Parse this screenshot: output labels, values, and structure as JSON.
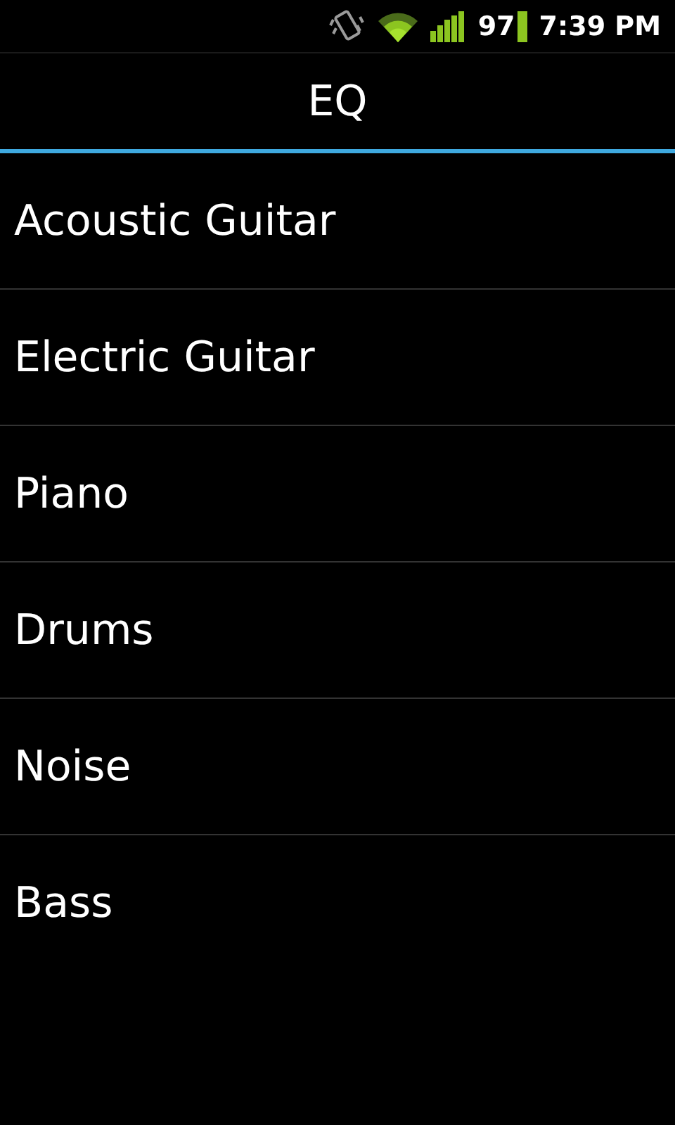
{
  "status_bar": {
    "battery_percent": "97",
    "time": "7:39 PM"
  },
  "title": "EQ",
  "items": [
    {
      "label": "Acoustic Guitar"
    },
    {
      "label": "Electric Guitar"
    },
    {
      "label": "Piano"
    },
    {
      "label": "Drums"
    },
    {
      "label": "Noise"
    },
    {
      "label": "Bass"
    }
  ]
}
